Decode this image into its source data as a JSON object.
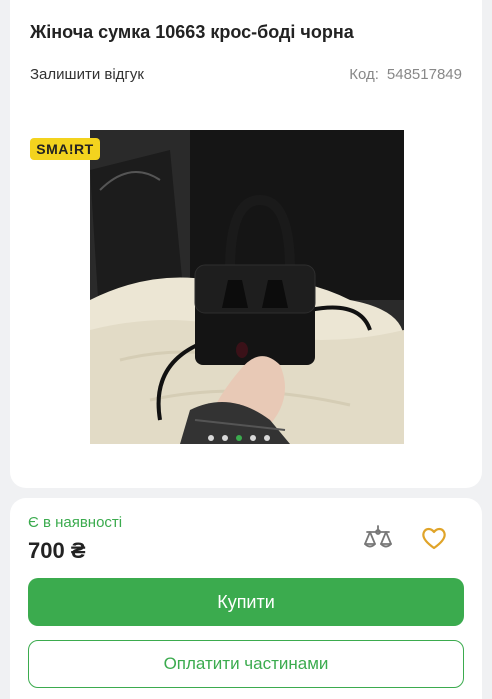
{
  "product": {
    "title": "Жіноча сумка 10663 крос-боді чорна",
    "review_link": "Залишити відгук",
    "code_label": "Код:",
    "code_value": "548517849",
    "badge": "SMA!RT",
    "image_dots": 5,
    "active_dot": 2
  },
  "purchase": {
    "stock_status": "Є в наявності",
    "price": "700 ₴",
    "buy_label": "Купити",
    "installments_label": "Оплатити частинами"
  },
  "icons": {
    "compare": "compare-scales-icon",
    "favorite": "heart-icon"
  },
  "colors": {
    "accent": "#3bab4e",
    "badge": "#f3d31e"
  }
}
